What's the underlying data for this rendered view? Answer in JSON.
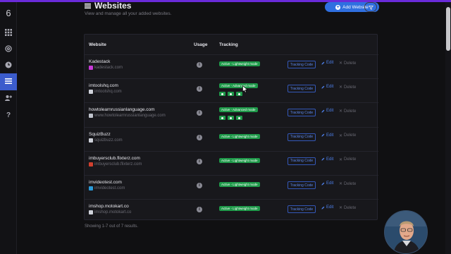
{
  "app": {
    "brand": "6"
  },
  "sidebar": {
    "items": [
      {
        "icon": "grid-icon",
        "label": ""
      },
      {
        "icon": "target-icon",
        "label": ""
      },
      {
        "icon": "clock-icon",
        "label": ""
      },
      {
        "icon": "list-icon",
        "label": "",
        "active": true
      },
      {
        "icon": "users-icon",
        "label": ""
      },
      {
        "icon": "help-icon",
        "label": "?"
      }
    ]
  },
  "header": {
    "title": "Websites",
    "subtitle": "View and manage all your added websites.",
    "add_button": "Add Website",
    "filter_icon": "filter-icon"
  },
  "table": {
    "columns": [
      "Website",
      "Usage",
      "Tracking"
    ],
    "tracking_code_label": "Tracking Code",
    "edit_label": "Edit",
    "delete_label": "Delete",
    "rows": [
      {
        "name": "Kadestack",
        "url": "kadestack.com",
        "favicon_color": "#c83ad8",
        "status": "Active - Lightweight mode",
        "mode": "lightweight"
      },
      {
        "name": "imtoolshq.com",
        "url": "imtoolshq.com",
        "favicon_color": "#cfd2da",
        "status": "Active - Advanced mode",
        "mode": "advanced"
      },
      {
        "name": "howtolearnrussianlanguage.com",
        "url": "www.howtolearnrussianlanguage.com",
        "favicon_color": "#bfc3cc",
        "status": "Active - Advanced mode",
        "mode": "advanced"
      },
      {
        "name": "SquizBuzz",
        "url": "squizbuzz.com",
        "favicon_color": "#cfd2da",
        "status": "Active - Lightweight mode",
        "mode": "lightweight"
      },
      {
        "name": "imbuyersclub.flixterz.com",
        "url": "imbuyersclub.flixterz.com",
        "favicon_color": "#d0402e",
        "status": "Active - Lightweight mode",
        "mode": "lightweight"
      },
      {
        "name": "imvideotest.com",
        "url": "imvideotest.com",
        "favicon_color": "#2a9ad8",
        "status": "Active - Lightweight mode",
        "mode": "lightweight"
      },
      {
        "name": "imshop.motokart.co",
        "url": "imshop.motokart.co",
        "favicon_color": "#cfd2da",
        "status": "Active - Lightweight mode",
        "mode": "lightweight"
      }
    ]
  },
  "footer": {
    "text": "Showing 1-7 out of 7 results."
  },
  "colors": {
    "accent": "#2f6fe0",
    "active_nav": "#3b5ccc",
    "success": "#1f9a4a",
    "top_bar": "#6a2bd9"
  }
}
